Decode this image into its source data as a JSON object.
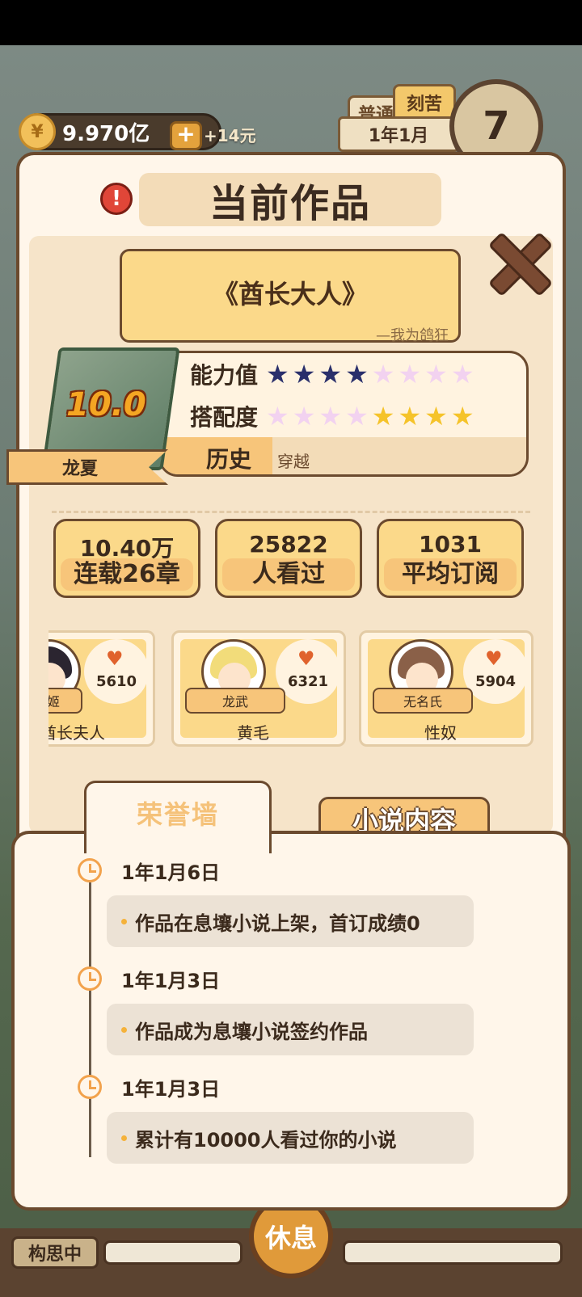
{
  "hud": {
    "coins": "9.970亿",
    "coin_icon_glyph": "¥",
    "plus": "+",
    "income": "+14元",
    "mode_normal": "普通",
    "mode_hard": "刻苦",
    "date": "1年1月",
    "day": "7"
  },
  "panel": {
    "alert_glyph": "!",
    "title": "当前作品"
  },
  "novel": {
    "title": "《酋长大人》",
    "author": "—我为鸽狂",
    "score": "10.0",
    "region": "龙夏",
    "ability_label": "能力值",
    "ability_stars": 4,
    "match_label": "搭配度",
    "match_stars": 4,
    "stars_total": 8,
    "genre_label": "历史",
    "genre_value": "穿越"
  },
  "stats": [
    {
      "num": "10.40万",
      "label": "连载26章"
    },
    {
      "num": "25822",
      "label": "人看过"
    },
    {
      "num": "1031",
      "label": "平均订阅"
    }
  ],
  "characters": [
    {
      "origin": "姬",
      "name": "酋长夫人",
      "likes": "5610",
      "hair": "#2b2530"
    },
    {
      "origin": "龙武",
      "name": "黄毛",
      "likes": "6321",
      "hair": "#f2dc7a"
    },
    {
      "origin": "无名氏",
      "name": "性奴",
      "likes": "5904",
      "hair": "#8a6048"
    }
  ],
  "tabs": {
    "honor": "荣誉墙",
    "content": "小说内容"
  },
  "events": [
    {
      "date": "1年1月6日",
      "text": "作品在息壤小说上架，首订成绩0"
    },
    {
      "date": "1年1月3日",
      "text": "作品成为息壤小说签约作品"
    },
    {
      "date": "1年1月3日",
      "text": "累计有10000人看过你的小说"
    }
  ],
  "bottom": {
    "thinking": "构思中",
    "rest": "休息"
  },
  "colors": {
    "panel_bg": "#fff6ea",
    "accent_orange": "#f7c57a",
    "border_brown": "#6b4a2e",
    "star_navy": "#2a2f6b",
    "star_gold": "#f5c32a"
  }
}
